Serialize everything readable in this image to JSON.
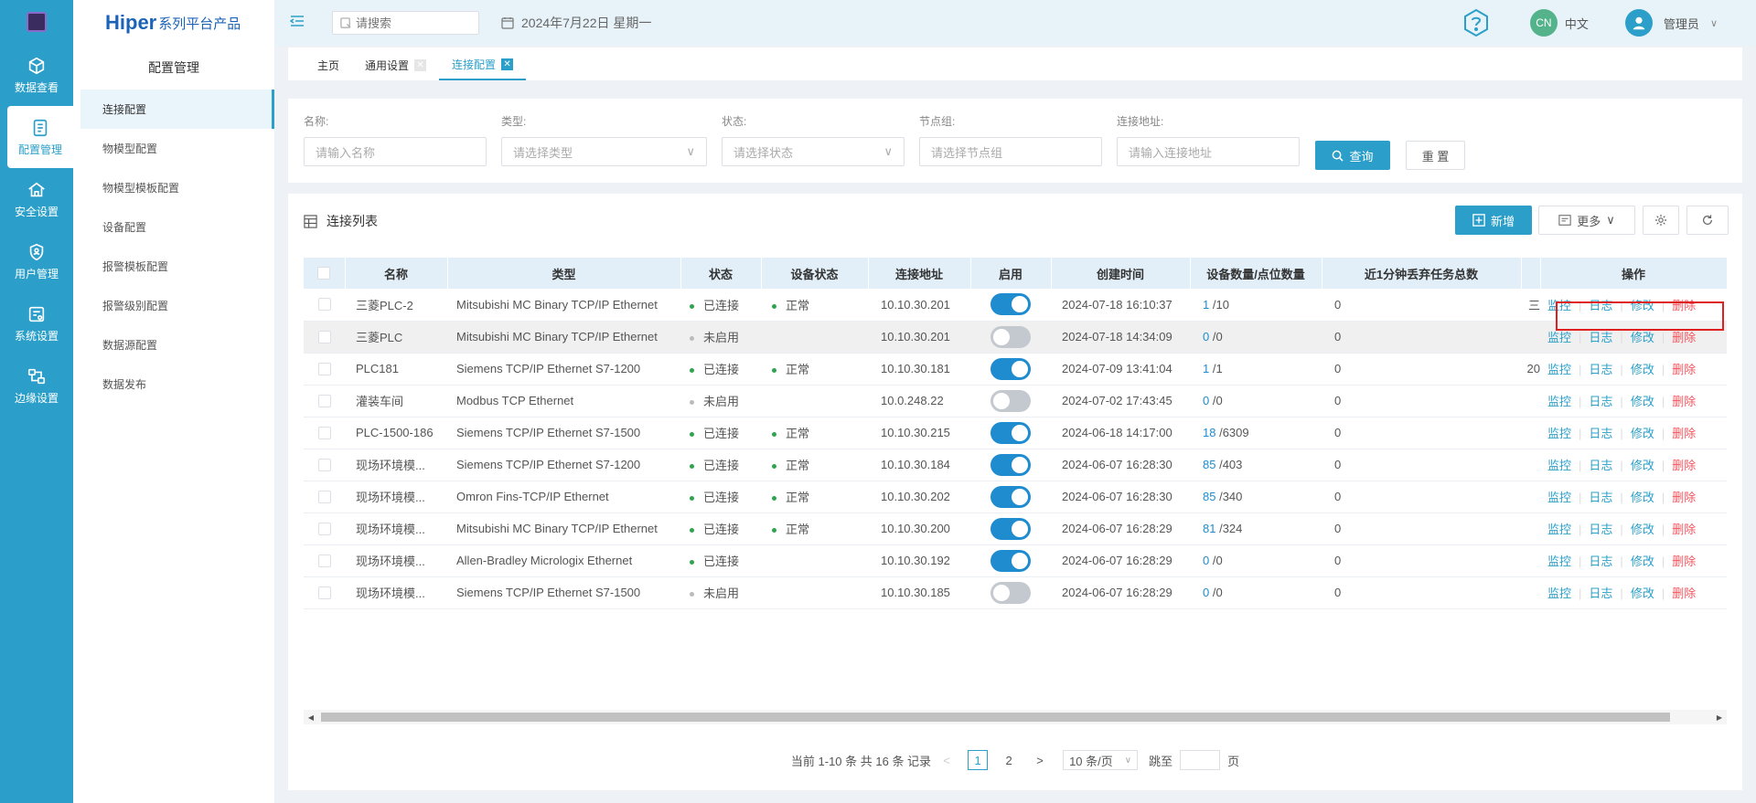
{
  "rail": {
    "items": [
      {
        "label": "数据查看",
        "icon": "cube-icon"
      },
      {
        "label": "配置管理",
        "icon": "config-icon"
      },
      {
        "label": "安全设置",
        "icon": "home-shield-icon"
      },
      {
        "label": "用户管理",
        "icon": "user-shield-icon"
      },
      {
        "label": "系统设置",
        "icon": "system-icon"
      },
      {
        "label": "边缘设置",
        "icon": "edge-icon"
      }
    ]
  },
  "brand": {
    "name": "Hiper",
    "tagline": "系列平台产品"
  },
  "submenu": {
    "title": "配置管理",
    "items": [
      "连接配置",
      "物模型配置",
      "物模型模板配置",
      "设备配置",
      "报警模板配置",
      "报警级别配置",
      "数据源配置",
      "数据发布"
    ]
  },
  "topbar": {
    "search_placeholder": "请搜索",
    "date": "2024年7月22日 星期一",
    "lang_avatar": "CN",
    "lang": "中文",
    "user": "管理员"
  },
  "tabs": [
    {
      "label": "主页",
      "closable": false
    },
    {
      "label": "通用设置",
      "closable": true
    },
    {
      "label": "连接配置",
      "closable": true,
      "active": true
    }
  ],
  "filters": {
    "name": {
      "label": "名称:",
      "placeholder": "请输入名称"
    },
    "type": {
      "label": "类型:",
      "placeholder": "请选择类型"
    },
    "status": {
      "label": "状态:",
      "placeholder": "请选择状态"
    },
    "group": {
      "label": "节点组:",
      "placeholder": "请选择节点组"
    },
    "address": {
      "label": "连接地址:",
      "placeholder": "请输入连接地址"
    },
    "query_label": "查询",
    "reset_label": "重 置"
  },
  "panel": {
    "title": "连接列表",
    "add_label": "新增",
    "more_label": "更多"
  },
  "table": {
    "headers": [
      "名称",
      "类型",
      "状态",
      "设备状态",
      "连接地址",
      "启用",
      "创建时间",
      "设备数量/点位数量",
      "近1分钟丢弃任务总数",
      "",
      "操作"
    ],
    "rows": [
      {
        "name": "三菱PLC-2",
        "type": "Mitsubishi MC Binary TCP/IP Ethernet",
        "status": "已连接",
        "status_on": true,
        "dev": "正常",
        "addr": "10.10.30.201",
        "enabled": true,
        "created": "2024-07-18 16:10:37",
        "dev_count": "1",
        "pt_count": "/10",
        "dropped": "0",
        "extra": "三"
      },
      {
        "name": "三菱PLC",
        "type": "Mitsubishi MC Binary TCP/IP Ethernet",
        "status": "未启用",
        "status_on": false,
        "dev": "",
        "addr": "10.10.30.201",
        "enabled": false,
        "created": "2024-07-18 14:34:09",
        "dev_count": "0",
        "pt_count": "/0",
        "dropped": "0",
        "extra": ""
      },
      {
        "name": "PLC181",
        "type": "Siemens TCP/IP Ethernet S7-1200",
        "status": "已连接",
        "status_on": true,
        "dev": "正常",
        "addr": "10.10.30.181",
        "enabled": true,
        "created": "2024-07-09 13:41:04",
        "dev_count": "1",
        "pt_count": "/1",
        "dropped": "0",
        "extra": "20"
      },
      {
        "name": "灌装车间",
        "type": "Modbus TCP Ethernet",
        "status": "未启用",
        "status_on": false,
        "dev": "",
        "addr": "10.0.248.22",
        "enabled": false,
        "created": "2024-07-02 17:43:45",
        "dev_count": "0",
        "pt_count": "/0",
        "dropped": "0",
        "extra": ""
      },
      {
        "name": "PLC-1500-186",
        "type": "Siemens TCP/IP Ethernet S7-1500",
        "status": "已连接",
        "status_on": true,
        "dev": "正常",
        "addr": "10.10.30.215",
        "enabled": true,
        "created": "2024-06-18 14:17:00",
        "dev_count": "18",
        "pt_count": "/6309",
        "dropped": "0",
        "extra": ""
      },
      {
        "name": "现场环境模...",
        "type": "Siemens TCP/IP Ethernet S7-1200",
        "status": "已连接",
        "status_on": true,
        "dev": "正常",
        "addr": "10.10.30.184",
        "enabled": true,
        "created": "2024-06-07 16:28:30",
        "dev_count": "85",
        "pt_count": "/403",
        "dropped": "0",
        "extra": ""
      },
      {
        "name": "现场环境模...",
        "type": "Omron Fins-TCP/IP Ethernet",
        "status": "已连接",
        "status_on": true,
        "dev": "正常",
        "addr": "10.10.30.202",
        "enabled": true,
        "created": "2024-06-07 16:28:30",
        "dev_count": "85",
        "pt_count": "/340",
        "dropped": "0",
        "extra": ""
      },
      {
        "name": "现场环境模...",
        "type": "Mitsubishi MC Binary TCP/IP Ethernet",
        "status": "已连接",
        "status_on": true,
        "dev": "正常",
        "addr": "10.10.30.200",
        "enabled": true,
        "created": "2024-06-07 16:28:29",
        "dev_count": "81",
        "pt_count": "/324",
        "dropped": "0",
        "extra": ""
      },
      {
        "name": "现场环境模...",
        "type": "Allen-Bradley Micrologix Ethernet",
        "status": "已连接",
        "status_on": true,
        "dev": "",
        "addr": "10.10.30.192",
        "enabled": true,
        "created": "2024-06-07 16:28:29",
        "dev_count": "0",
        "pt_count": "/0",
        "dropped": "0",
        "extra": ""
      },
      {
        "name": "现场环境模...",
        "type": "Siemens TCP/IP Ethernet S7-1500",
        "status": "未启用",
        "status_on": false,
        "dev": "",
        "addr": "10.10.30.185",
        "enabled": false,
        "created": "2024-06-07 16:28:29",
        "dev_count": "0",
        "pt_count": "/0",
        "dropped": "0",
        "extra": ""
      }
    ],
    "actions": {
      "monitor": "监控",
      "log": "日志",
      "edit": "修改",
      "delete": "删除"
    }
  },
  "pager": {
    "summary": "当前 1-10 条 共 16 条 记录",
    "pages": [
      "1",
      "2"
    ],
    "current": "1",
    "page_size": "10 条/页",
    "jump_label": "跳至",
    "page_unit": "页"
  },
  "colors": {
    "accent": "#2b9fc9",
    "danger": "#f2555e",
    "success": "#2ea44f",
    "highlight_border": "#e02020"
  }
}
